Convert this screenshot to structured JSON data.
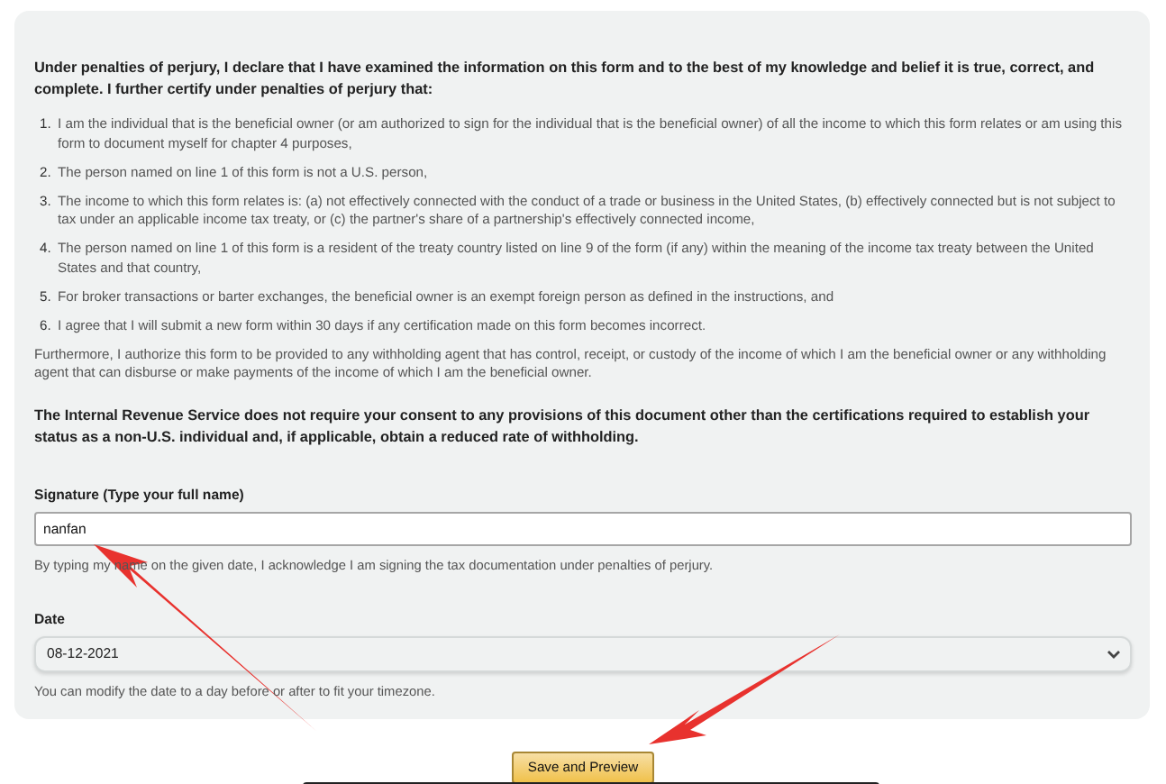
{
  "declaration": {
    "intro": "Under penalties of perjury, I declare that I have examined the information on this form and to the best of my knowledge and belief it is true, correct, and complete. I further certify under penalties of perjury that:",
    "items": [
      {
        "number": "1.",
        "text": "I am the individual that is the beneficial owner (or am authorized to sign for the individual that is the beneficial owner) of all the income to which this form relates or am using this form to document myself for chapter 4 purposes,"
      },
      {
        "number": "2.",
        "text": "The person named on line 1 of this form is not a U.S. person,"
      },
      {
        "number": "3.",
        "text": "The income to which this form relates is: (a) not effectively connected with the conduct of a trade or business in the United States, (b) effectively connected but is not subject to tax under an applicable income tax treaty, or (c) the partner's share of a partnership's effectively connected income,"
      },
      {
        "number": "4.",
        "text": "The person named on line 1 of this form is a resident of the treaty country listed on line 9 of the form (if any) within the meaning of the income tax treaty between the United States and that country,"
      },
      {
        "number": "5.",
        "text": "For broker transactions or barter exchanges, the beneficial owner is an exempt foreign person as defined in the instructions, and"
      },
      {
        "number": "6.",
        "text": "I agree that I will submit a new form within 30 days if any certification made on this form becomes incorrect."
      }
    ],
    "furthermore": "Furthermore, I authorize this form to be provided to any withholding agent that has control, receipt, or custody of the income of which I am the beneficial owner or any withholding agent that can disburse or make payments of the income of which I am the beneficial owner.",
    "notice": "The Internal Revenue Service does not require your consent to any provisions of this document other than the certifications required to establish your status as a non-U.S. individual and, if applicable, obtain a reduced rate of withholding."
  },
  "signature": {
    "label": "Signature (Type your full name)",
    "value": "nanfan",
    "help": "By typing my name on the given date, I acknowledge I am signing the tax documentation under penalties of perjury."
  },
  "date": {
    "label": "Date",
    "value": "08-12-2021",
    "hint": "You can modify the date to a day before or after to fit your timezone."
  },
  "button": {
    "label": "Save and Preview"
  }
}
